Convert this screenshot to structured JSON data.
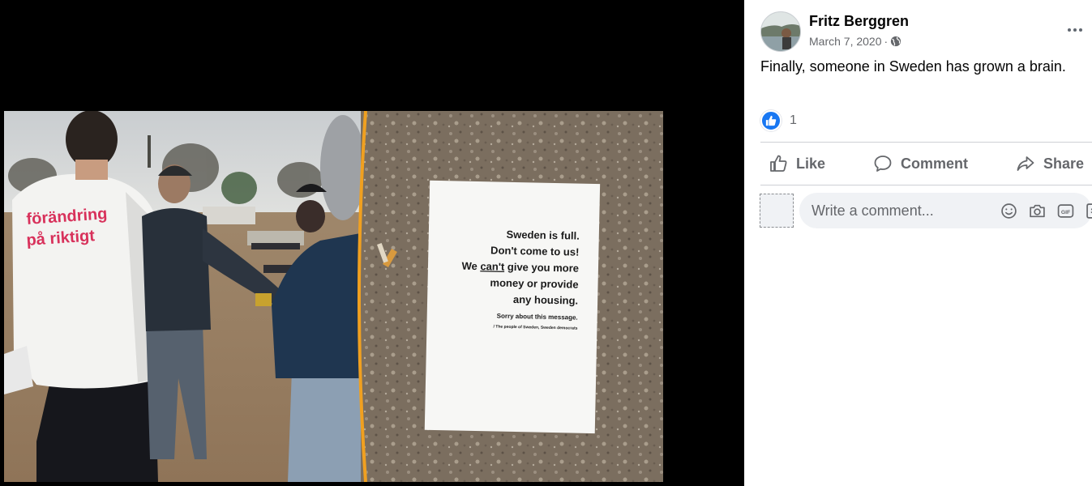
{
  "photo": {
    "jacket_text_line1": "förändring",
    "jacket_text_line2": "på riktigt",
    "sign_lines": [
      "Sweden is full.",
      "Don't come to us!"
    ],
    "sign_line3_prefix": "We ",
    "sign_line3_underlined": "can't",
    "sign_line3_suffix": " give you more",
    "sign_lines_tail": [
      "money or provide",
      "any housing."
    ],
    "sign_small": "Sorry about this message.",
    "sign_signature": "/ The people of Sweden, Sweden democrats"
  },
  "post": {
    "author": "Fritz Berggren",
    "date": "March 7, 2020",
    "separator": "·",
    "privacy_icon": "globe-icon",
    "text": "Finally, someone in Sweden has grown a brain.",
    "reaction_icon": "like-reaction-icon",
    "reaction_count": "1"
  },
  "actions": {
    "like": "Like",
    "comment": "Comment",
    "share": "Share"
  },
  "comment_box": {
    "placeholder": "Write a comment...",
    "icons": [
      "emoji-icon",
      "camera-icon",
      "gif-icon",
      "sticker-icon"
    ]
  },
  "colors": {
    "brand_blue": "#1877f2",
    "secondary_text": "#65676b",
    "divider": "#ced0d4",
    "input_bg": "#f0f2f5"
  }
}
